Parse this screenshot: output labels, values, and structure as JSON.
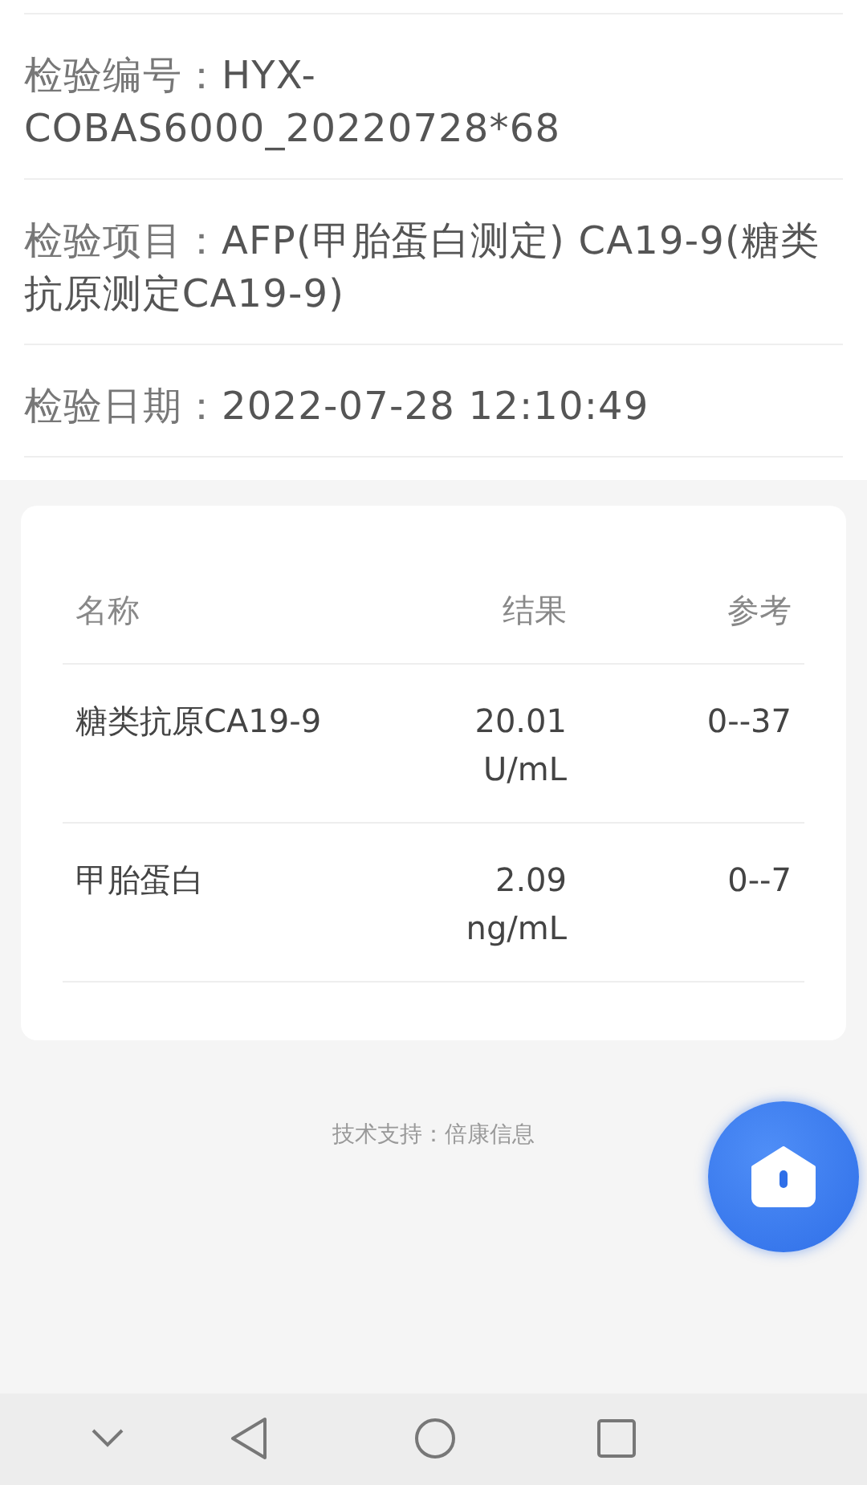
{
  "info": [
    {
      "label": "检验编号：",
      "value": "HYX-COBAS6000_20220728*68"
    },
    {
      "label": "检验项目：",
      "value": "AFP(甲胎蛋白测定) CA19-9(糖类抗原测定CA19-9)"
    },
    {
      "label": "检验日期：",
      "value": "2022-07-28 12:10:49"
    }
  ],
  "table": {
    "columns": [
      "名称",
      "结果",
      "参考"
    ],
    "rows": [
      {
        "name": "糖类抗原CA19-9",
        "result": "20.01 U/mL",
        "reference": "0--37"
      },
      {
        "name": "甲胎蛋白",
        "result": "2.09 ng/mL",
        "reference": "0--7"
      }
    ]
  },
  "footer": "技术支持：倍康信息"
}
